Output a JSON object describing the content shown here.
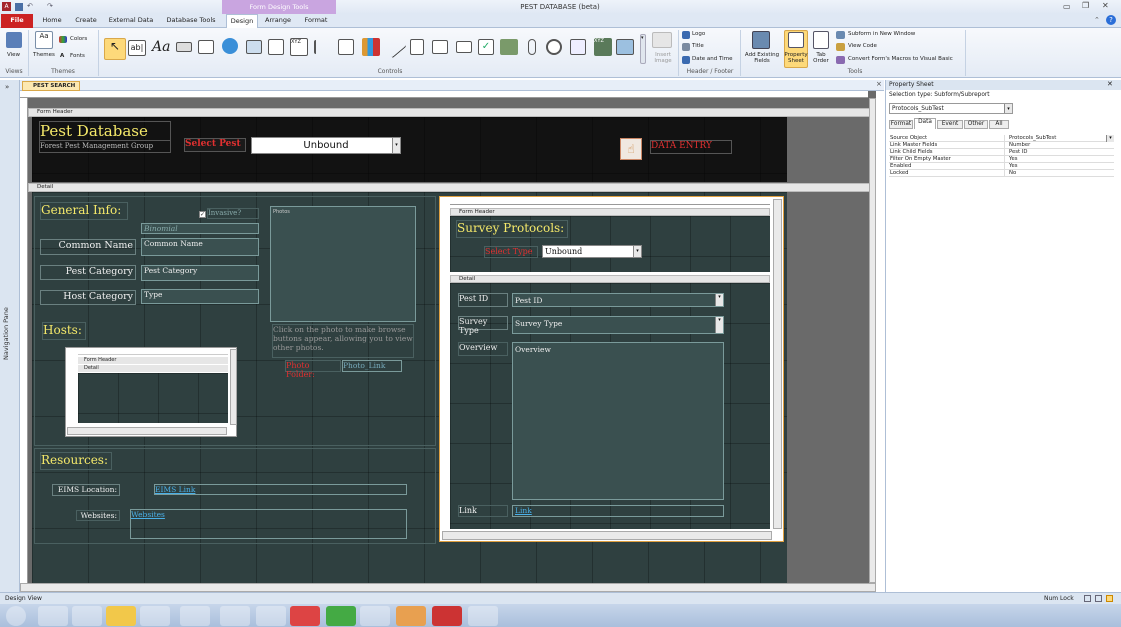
{
  "app": {
    "title": "PEST DATABASE (beta)",
    "context_tab": "Form Design Tools"
  },
  "tabs": [
    "File",
    "Home",
    "Create",
    "External Data",
    "Database Tools",
    "Design",
    "Arrange",
    "Format"
  ],
  "ribbon": {
    "views": {
      "view": "View",
      "label": "Views"
    },
    "themes": {
      "themes": "Themes",
      "colors": "Colors",
      "fonts": "Fonts",
      "label": "Themes"
    },
    "controls_label": "Controls",
    "insert_image": "Insert Image",
    "header_footer": {
      "logo": "Logo",
      "title": "Title",
      "date_time": "Date and Time",
      "label": "Header / Footer"
    },
    "tools": {
      "add_existing": "Add Existing Fields",
      "property_sheet": "Property Sheet",
      "tab_order": "Tab Order",
      "subform_window": "Subform in New Window",
      "view_code": "View Code",
      "convert_macros": "Convert Form's Macros to Visual Basic",
      "label": "Tools"
    }
  },
  "nav": {
    "label": "Navigation Pane"
  },
  "doc_tab": "PEST SEARCH",
  "form": {
    "form_header_band": "Form Header",
    "detail_band": "Detail",
    "title": "Pest Database",
    "subtitle": "Forest Pest Management Group",
    "select_pest": "Select Pest",
    "select_value": "Unbound",
    "data_entry": "DATA ENTRY",
    "general_info": "General Info:",
    "invasive": "Invasive?",
    "binomial": "Binomial",
    "photos": "Photos",
    "common_name_label": "Common Name",
    "common_name_field": "Common Name",
    "pest_category_label": "Pest Category",
    "pest_category_field": "Pest Category",
    "host_category_label": "Host Category",
    "host_category_field": "Type",
    "hosts": "Hosts:",
    "photo_hint": "Click on the photo to make browse buttons appear, allowing you to view other photos.",
    "photo_folder": "Photo Folder:",
    "photo_link": "Photo_Link",
    "resources": "Resources:",
    "eims_label": "EIMS Location:",
    "eims_link": "EIMS Link",
    "websites_label": "Websites:",
    "websites_link": "Websites",
    "sub_form_header": "Form Header",
    "sub_detail": "Detail"
  },
  "subform": {
    "form_header_band": "Form Header",
    "detail_band": "Detail",
    "title": "Survey Protocols:",
    "select_type": "Select Type",
    "select_value": "Unbound",
    "pest_id_label": "Pest ID",
    "pest_id_field": "Pest ID",
    "survey_type_label": "Survey Type",
    "survey_type_field": "Survey Type",
    "overview_label": "Overview",
    "overview_field": "Overview",
    "link_label": "Link",
    "link_field": "Link"
  },
  "property_sheet": {
    "title": "Property Sheet",
    "selection_type": "Selection type:  Subform/Subreport",
    "object": "Protocols_SubTest",
    "tabs": [
      "Format",
      "Data",
      "Event",
      "Other",
      "All"
    ],
    "rows": [
      {
        "k": "Source Object",
        "v": "Protocols_SubTest"
      },
      {
        "k": "Link Master Fields",
        "v": "Number"
      },
      {
        "k": "Link Child Fields",
        "v": "Pest ID"
      },
      {
        "k": "Filter On Empty Master",
        "v": "Yes"
      },
      {
        "k": "Enabled",
        "v": "Yes"
      },
      {
        "k": "Locked",
        "v": "No"
      }
    ]
  },
  "status": {
    "left": "Design View",
    "right": "Num Lock"
  }
}
